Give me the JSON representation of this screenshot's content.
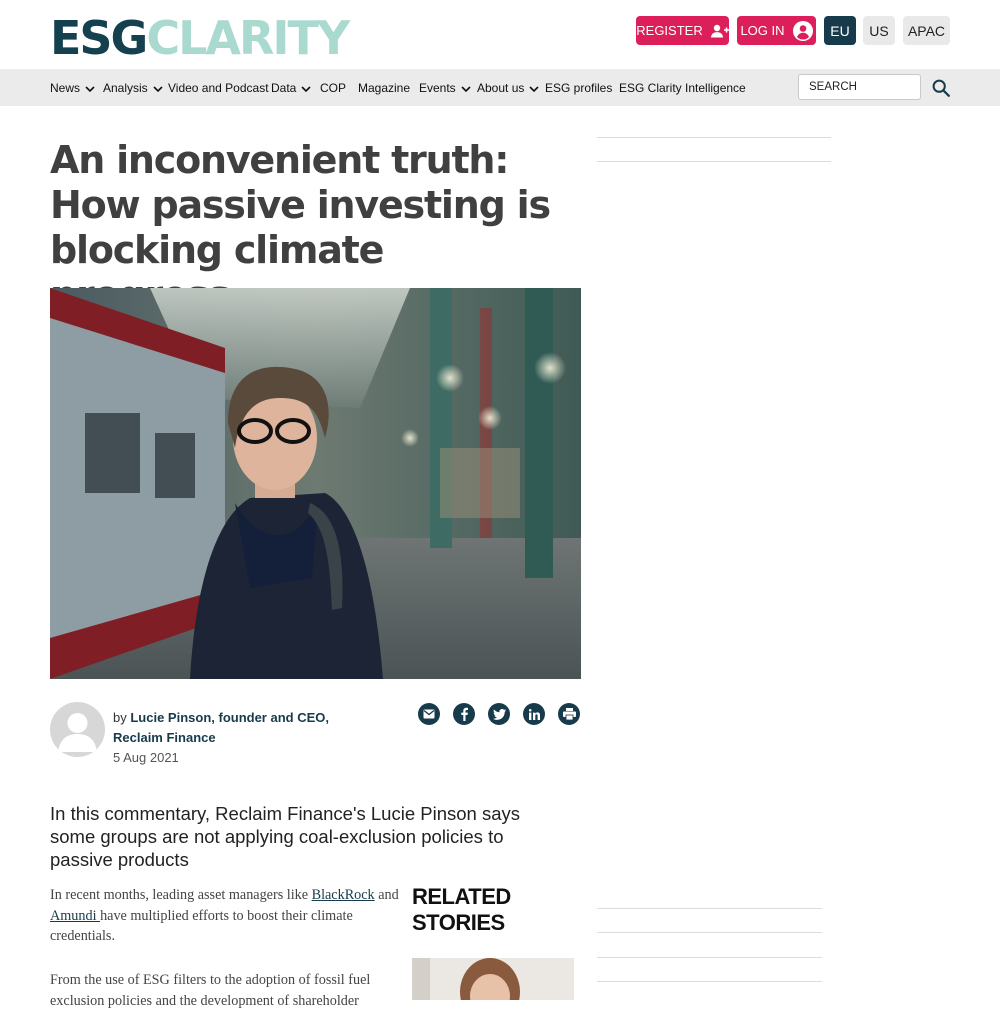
{
  "header": {
    "logo_primary": "ESG",
    "logo_secondary": "CLARITY",
    "register_label": "REGISTER",
    "login_label": "LOG IN",
    "regions": [
      "EU",
      "US",
      "APAC"
    ],
    "selected_region": "EU"
  },
  "nav": {
    "items": [
      {
        "label": "News",
        "has_dropdown": true
      },
      {
        "label": "Analysis",
        "has_dropdown": true
      },
      {
        "label": "Video and Podcast",
        "has_dropdown": false
      },
      {
        "label": "Data",
        "has_dropdown": true
      },
      {
        "label": "COP",
        "has_dropdown": false
      },
      {
        "label": "Magazine",
        "has_dropdown": false
      },
      {
        "label": "Events",
        "has_dropdown": true
      },
      {
        "label": "About us",
        "has_dropdown": true
      },
      {
        "label": "ESG profiles",
        "has_dropdown": false
      },
      {
        "label": "ESG Clarity Intelligence",
        "has_dropdown": false
      }
    ],
    "search_placeholder": "SEARCH"
  },
  "article": {
    "title": "An inconvenient truth: How passive investing is blocking climate progress",
    "author_prefix": "by",
    "author_name": "Lucie Pinson, founder and CEO, Reclaim Finance",
    "date": "5 Aug 2021",
    "standfirst": "In this commentary, Reclaim Finance's Lucie Pinson says some groups are not applying coal-exclusion policies to passive products",
    "para1": {
      "text_a": "In recent months, leading asset managers like ",
      "link1": "BlackRock",
      "text_b": " and ",
      "link2": "Amundi ",
      "text_c": "have multiplied efforts to boost their climate credentials."
    },
    "para2": "From the use of ESG filters to the adoption of fossil fuel exclusion policies and the development of shareholder"
  },
  "share_icons": [
    "email-icon",
    "facebook-icon",
    "twitter-icon",
    "linkedin-icon",
    "print-icon"
  ],
  "related": {
    "title": "RELATED STORIES"
  },
  "colors": {
    "brand_navy": "#173b4b",
    "brand_pink": "#dc1f5b",
    "logo_mint": "#aad9cf",
    "nav_bg": "#ebebeb"
  }
}
